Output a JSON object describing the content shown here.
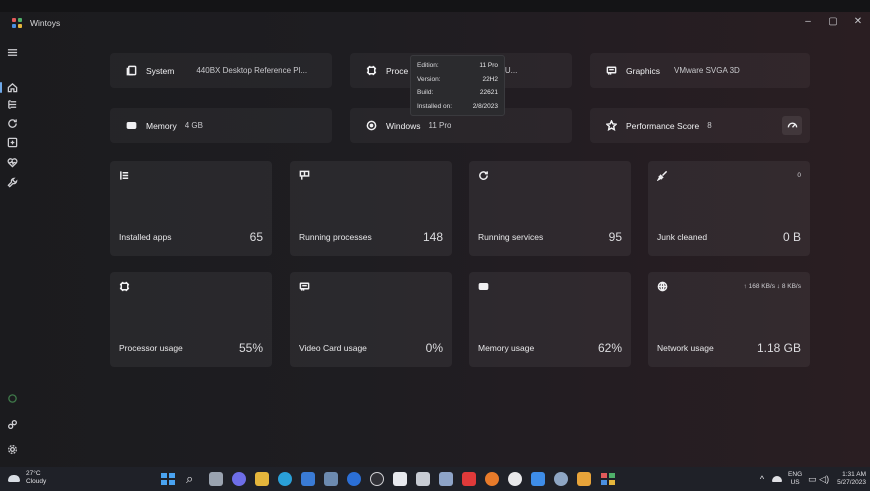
{
  "app": {
    "title": "Wintoys"
  },
  "window_controls": {
    "minimize": "–",
    "maximize": "▢",
    "close": "✕"
  },
  "sidebar": {
    "items": [
      {
        "name": "menu",
        "icon": "hamburger-icon"
      },
      {
        "name": "home",
        "icon": "home-icon",
        "active": true
      },
      {
        "name": "apps",
        "icon": "apps-list-icon"
      },
      {
        "name": "services",
        "icon": "refresh-icon"
      },
      {
        "name": "processes",
        "icon": "board-icon"
      },
      {
        "name": "health",
        "icon": "heart-pulse-icon"
      },
      {
        "name": "tweaks",
        "icon": "wrench-icon"
      }
    ],
    "bottom": [
      {
        "name": "loading",
        "icon": "spinner-icon"
      },
      {
        "name": "links",
        "icon": "link-icon"
      },
      {
        "name": "settings",
        "icon": "gear-icon"
      }
    ]
  },
  "info_cards": {
    "system": {
      "label": "System",
      "value": "440BX Desktop Reference Pl..."
    },
    "processor": {
      "label": "Proce",
      "value": "i5-4200U..."
    },
    "graphics": {
      "label": "Graphics",
      "value": "VMware SVGA 3D"
    },
    "memory": {
      "label": "Memory",
      "value": "4 GB"
    },
    "windows": {
      "label": "Windows",
      "value": "11 Pro"
    },
    "performance": {
      "label": "Performance Score",
      "value": "8"
    }
  },
  "tooltip": {
    "rows": [
      {
        "key": "Edition:",
        "value": "11 Pro"
      },
      {
        "key": "Version:",
        "value": "22H2"
      },
      {
        "key": "Build:",
        "value": "22621"
      },
      {
        "key": "Installed on:",
        "value": "2/8/2023"
      }
    ]
  },
  "tiles": {
    "installed_apps": {
      "label": "Installed apps",
      "value": "65"
    },
    "running_processes": {
      "label": "Running processes",
      "value": "148"
    },
    "running_services": {
      "label": "Running services",
      "value": "95"
    },
    "junk_cleaned": {
      "label": "Junk cleaned",
      "value": "0 B",
      "corner": "0"
    },
    "processor_usage": {
      "label": "Processor usage",
      "value": "55%"
    },
    "video_card_usage": {
      "label": "Video Card usage",
      "value": "0%"
    },
    "memory_usage": {
      "label": "Memory usage",
      "value": "62%"
    },
    "network_usage": {
      "label": "Network usage",
      "value": "1.18 GB",
      "corner": "↑ 168 KB/s ↓ 8 KB/s"
    }
  },
  "taskbar": {
    "weather": {
      "temp": "27°C",
      "condition": "Cloudy"
    },
    "language": {
      "top": "ENG",
      "bottom": "US"
    },
    "clock": {
      "time": "1:31 AM",
      "date": "5/27/2023"
    },
    "colors": {
      "windows_logo": "#4aa3f0",
      "accent": "#6fa9e9"
    }
  }
}
